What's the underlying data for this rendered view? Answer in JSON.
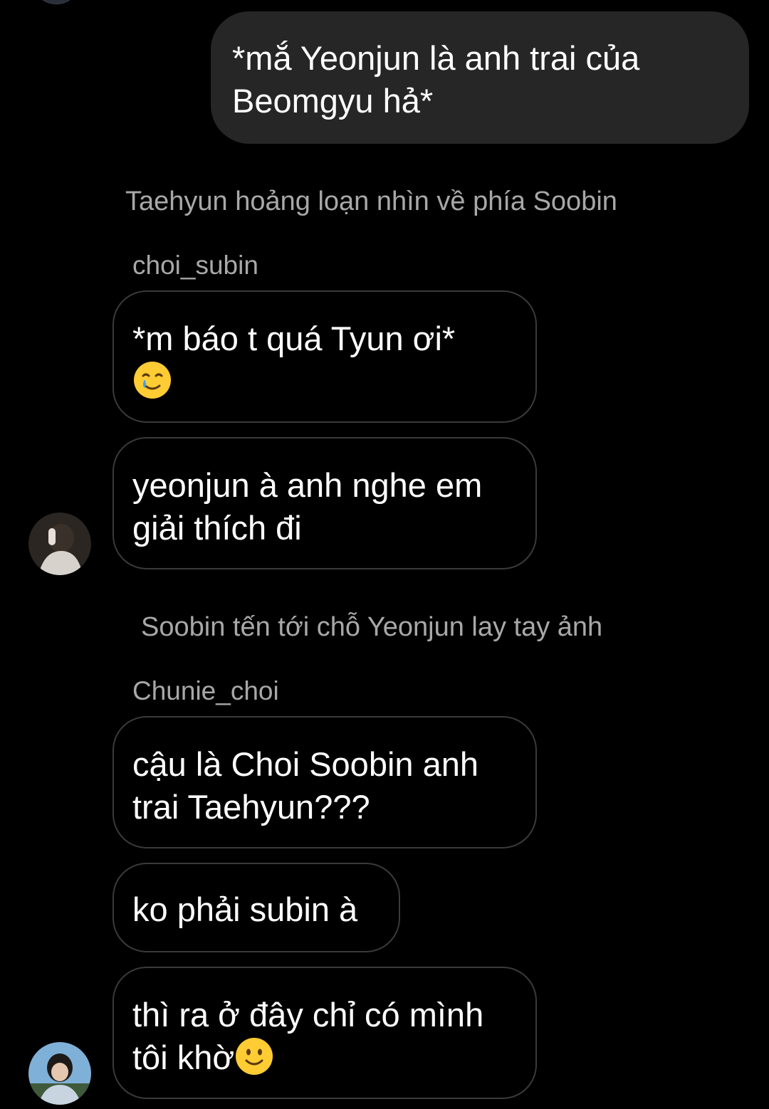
{
  "messages": [
    {
      "type": "outgoing",
      "lines": [
        "*mắ Yeonjun là anh trai của",
        "Beomgyu hả*"
      ]
    },
    {
      "type": "narration",
      "text": "Taehyun hoảng loạn nhìn về phía Soobin"
    },
    {
      "type": "sender",
      "name": "choi_subin"
    },
    {
      "type": "incoming",
      "lines": [
        "*m báo t quá Tyun ơi*"
      ],
      "emoji": "smiling-face-with-tear"
    },
    {
      "type": "incoming",
      "lines": [
        "yeonjun à anh nghe em",
        "giải thích đi"
      ],
      "avatar": "avatar-choi-subin"
    },
    {
      "type": "narration",
      "text": "Soobin tến tới chỗ Yeonjun lay tay ảnh"
    },
    {
      "type": "sender",
      "name": "Chunie_choi"
    },
    {
      "type": "incoming",
      "lines": [
        "cậu là Choi Soobin anh",
        "trai Taehyun???"
      ]
    },
    {
      "type": "incoming",
      "lines": [
        "ko phải subin à"
      ]
    },
    {
      "type": "incoming",
      "lines": [
        "thì ra ở đây chỉ có mình",
        "tôi khờ"
      ],
      "emoji": "slightly-smiling-face",
      "avatar": "avatar-chunie-choi"
    }
  ],
  "colors": {
    "background": "#000000",
    "outgoing_bubble": "#262626",
    "incoming_border": "#3a3a3a",
    "secondary_text": "#a8a8a8"
  }
}
